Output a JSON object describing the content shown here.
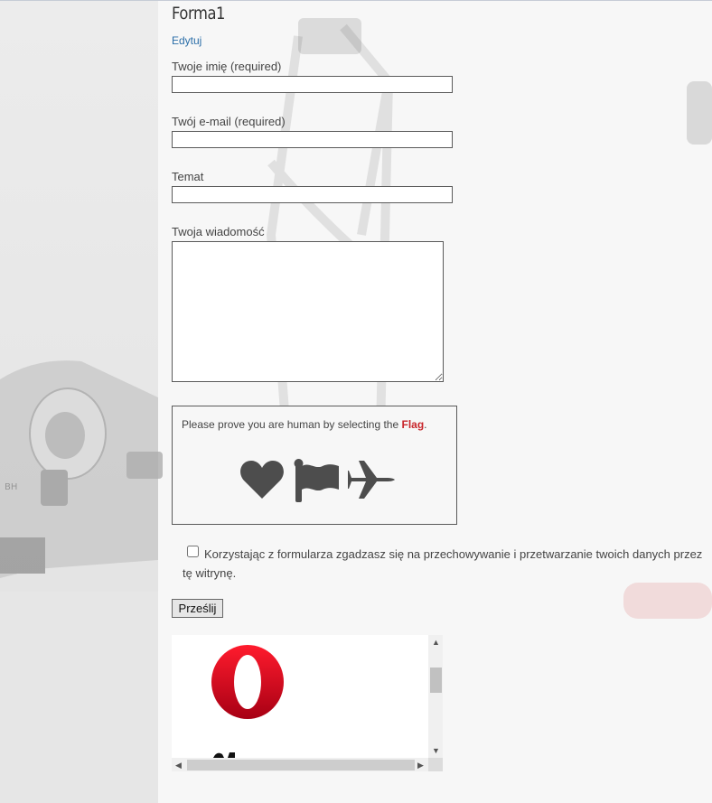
{
  "page": {
    "title": "Forma1",
    "edit_link": "Edytuj"
  },
  "form": {
    "name_label": "Twoje imię (required)",
    "name_value": "",
    "email_label": "Twój e-mail (required)",
    "email_value": "",
    "subject_label": "Temat",
    "subject_value": "",
    "message_label": "Twoja wiadomość",
    "message_value": ""
  },
  "captcha": {
    "prompt": "Please prove you are human by selecting the ",
    "target": "Flag",
    "suffix": ".",
    "icons": [
      "heart-icon",
      "flag-icon",
      "plane-icon"
    ],
    "target_color": "#c8262b"
  },
  "consent": {
    "checked": false,
    "text": "Korzystając z formularza zgadzasz się na przechowywanie i przetwarzanie twoich danych przez tę witrynę."
  },
  "submit": {
    "label": "Prześlij"
  },
  "embedded_frame": {
    "logo": "opera-logo",
    "scroll_up": "▲",
    "scroll_down": "▼",
    "scroll_left": "◀",
    "scroll_right": "▶"
  }
}
